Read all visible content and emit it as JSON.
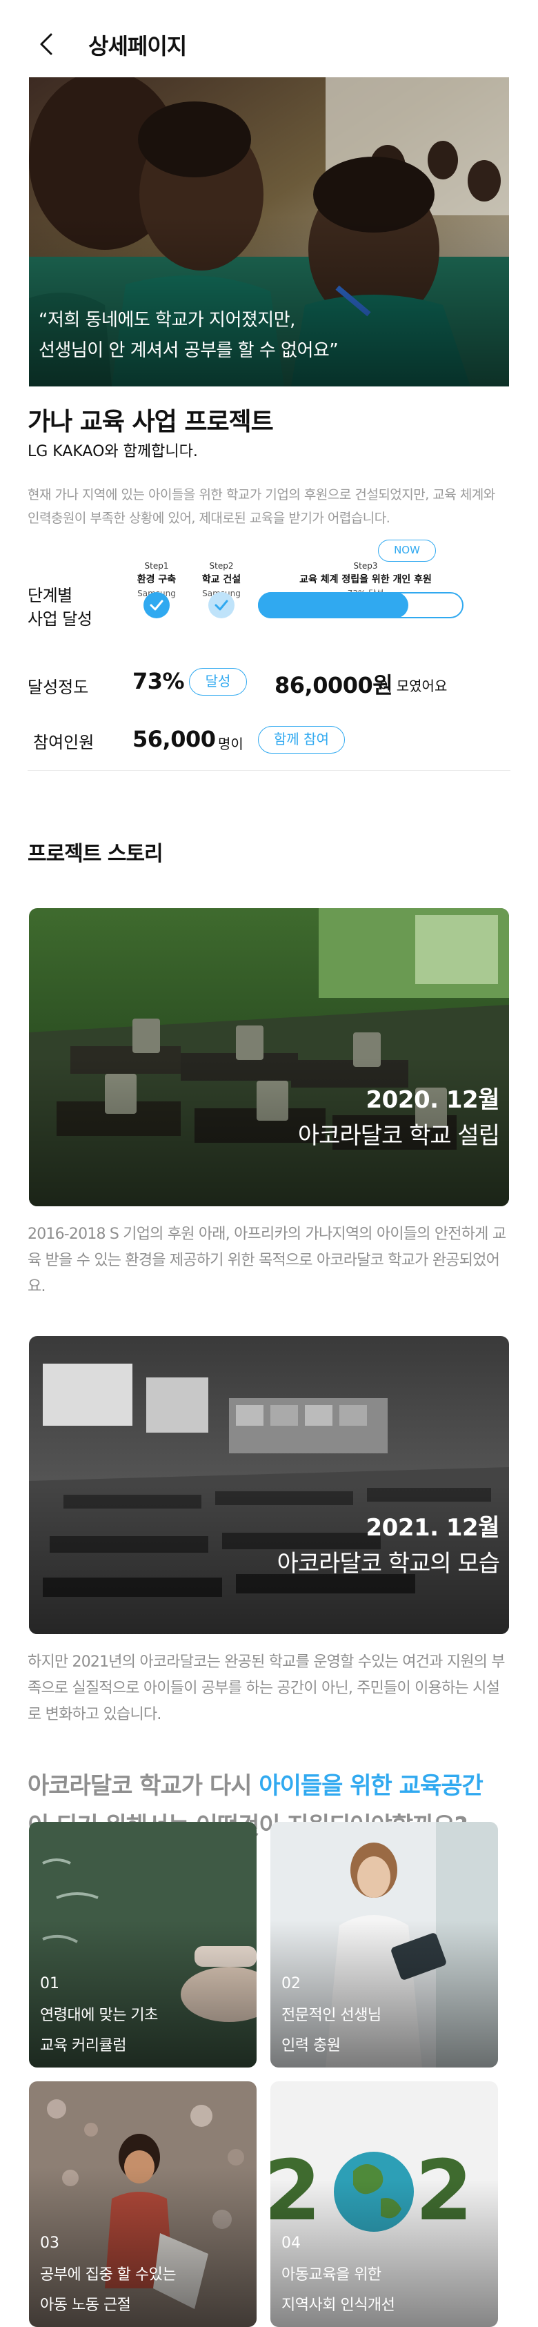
{
  "header": {
    "title": "상세페이지"
  },
  "hero": {
    "quote": "“저희 동네에도 학교가 지어졌지만,\n선생님이 안 계셔서 공부를 할 수 없어요”"
  },
  "project": {
    "title": "가나 교육 사업 프로젝트",
    "partners": "LG  KAKAO와 함께합니다.",
    "description": "현재 가나 지역에 있는 아이들을 위한 학교가 기업의 후원으로 건설되었지만, 교육 체계와 인력충원이 부족한 상황에 있어, 제대로된 교육을 받기가 어렵습니다."
  },
  "steps": {
    "label_line1": "단계별",
    "label_line2": "사업 달성",
    "now_label": "NOW",
    "items": [
      {
        "num": "Step1",
        "title": "환경 구축",
        "sponsor": "Samsung",
        "done": true
      },
      {
        "num": "Step2",
        "title": "학교 건설",
        "sponsor": "Samsung",
        "done": true
      },
      {
        "num": "Step3",
        "title": "교육 체계 정립을 위한 개인 후원",
        "sponsor": "73% 달성",
        "done": false
      }
    ],
    "progress": 0.73,
    "accent_color": "#30a9f0"
  },
  "achievement": {
    "label": "달성정도",
    "percent": "73%",
    "badge": "달성",
    "amount": "86,0000원",
    "amount_suffix": "이 모였어요"
  },
  "participants": {
    "label": "참여인원",
    "count": "56,000",
    "unit": "명이",
    "join_button": "함께 참여"
  },
  "story": {
    "section_title": "프로젝트 스토리",
    "items": [
      {
        "date": "2020. 12월",
        "caption": "아코라달코 학교 설립",
        "text": "2016-2018 S 기업의 후원 아래, 아프리카의 가나지역의 아이들의 안전하게 교육 받을 수 있는 환경을 제공하기 위한 목적으로 아코라달코 학교가 완공되었어요."
      },
      {
        "date": "2021. 12월",
        "caption": "아코라달코 학교의 모습",
        "text": "하지만 2021년의 아코라달코는 완공된 학교를 운영할 수있는 여건과 지원의 부족으로 실질적으로 아이들이 공부를 하는 공간이 아닌, 주민들이 이용하는 시설로 변화하고 있습니다."
      }
    ]
  },
  "question": {
    "prefix": "아코라달코 학교가 다시 ",
    "accent": "아이들을 위한 교육공간",
    "line2": "이 되기 위해서는 어떤것이 지원되어야할까요?"
  },
  "cards": [
    {
      "num": "01",
      "line1": "연령대에 맞는 기초",
      "line2": "교육 커리큘럼"
    },
    {
      "num": "02",
      "line1": "전문적인 선생님",
      "line2": "인력 충원"
    },
    {
      "num": "03",
      "line1": "공부에 집중 할 수있는",
      "line2": "아동 노동 근절"
    },
    {
      "num": "04",
      "line1": "아동교육을 위한",
      "line2": "지역사회 인식개선"
    }
  ]
}
